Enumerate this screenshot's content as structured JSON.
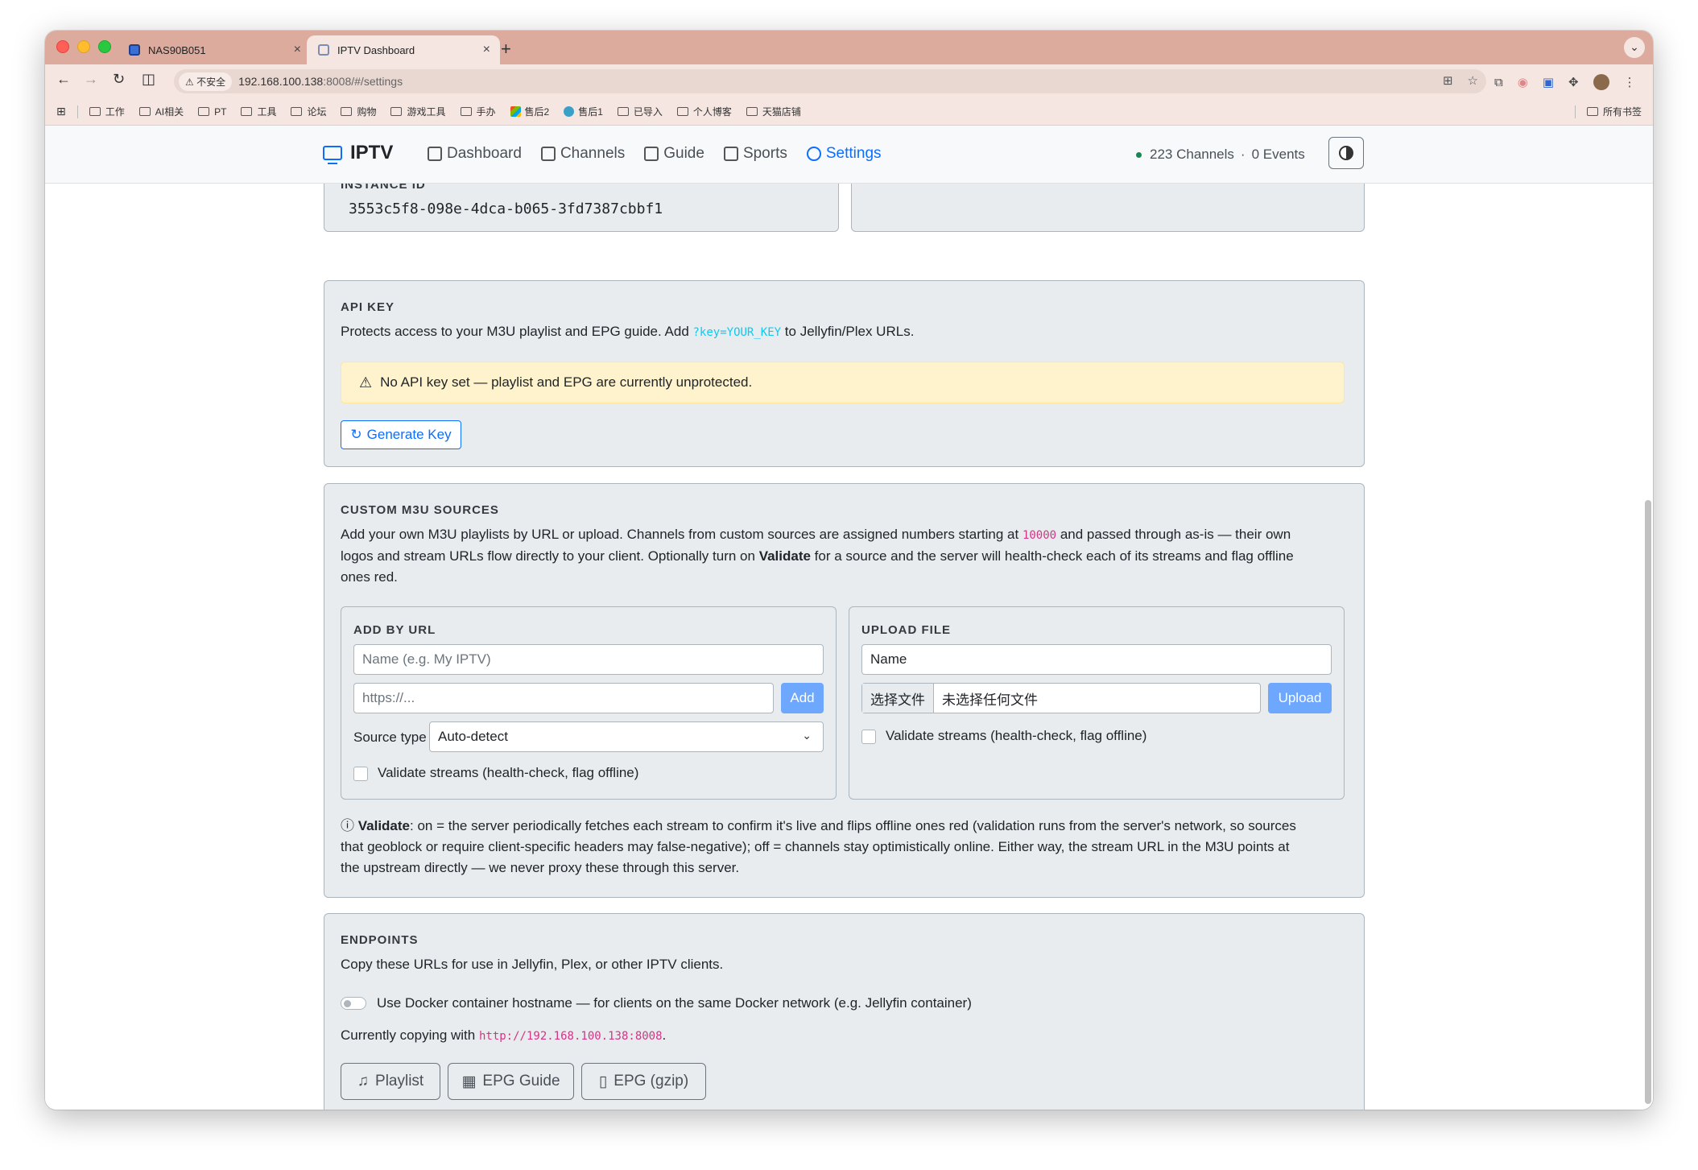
{
  "browser": {
    "tabs": [
      {
        "label": "NAS90B051"
      },
      {
        "label": "IPTV Dashboard"
      }
    ],
    "insecure_label": "不安全",
    "url_host": "192.168.100.138",
    "url_rest": ":8008/#/settings",
    "bookmarks": [
      "工作",
      "AI相关",
      "PT",
      "工具",
      "论坛",
      "购物",
      "游戏工具",
      "手办",
      "售后2",
      "售后1",
      "已导入",
      "个人博客",
      "天猫店铺"
    ],
    "bookmarks_right": "所有书签"
  },
  "nav": {
    "brand": "IPTV",
    "links": [
      {
        "label": "Dashboard"
      },
      {
        "label": "Channels"
      },
      {
        "label": "Guide"
      },
      {
        "label": "Sports"
      },
      {
        "label": "Settings"
      }
    ],
    "channels_count": "223 Channels",
    "events_count": "0 Events",
    "separator": "·"
  },
  "instance": {
    "label": "INSTANCE ID",
    "value": "3553c5f8-098e-4dca-b065-3fd7387cbbf1"
  },
  "api_key": {
    "title": "API KEY",
    "desc_pre": "Protects access to your M3U playlist and EPG guide. Add ",
    "desc_code": "?key=YOUR_KEY",
    "desc_post": " to Jellyfin/Plex URLs.",
    "alert": "No API key set — playlist and EPG are currently unprotected.",
    "generate_button": "Generate Key"
  },
  "custom_m3u": {
    "title": "CUSTOM M3U SOURCES",
    "desc_1": "Add your own M3U playlists by URL or upload. Channels from custom sources are assigned numbers starting at ",
    "desc_code": "10000",
    "desc_2": " and passed through as-is — their own",
    "desc_3_pre": "logos and stream URLs flow directly to your client. Optionally turn on ",
    "desc_3_bold": "Validate",
    "desc_3_post": " for a source and the server will health-check each of its streams and flag offline",
    "desc_4": "ones red.",
    "add_by_url": {
      "title": "ADD BY URL",
      "name_placeholder": "Name (e.g. My IPTV)",
      "url_placeholder": "https://...",
      "add_button": "Add",
      "source_type_label": "Source type",
      "source_type_value": "Auto-detect",
      "validate_label": "Validate streams (health-check, flag offline)"
    },
    "upload_file": {
      "title": "UPLOAD FILE",
      "name_placeholder": "Name",
      "choose_file": "选择文件",
      "no_file": "未选择任何文件",
      "upload_button": "Upload",
      "validate_label": "Validate streams (health-check, flag offline)"
    },
    "validate_note_bold": "Validate",
    "validate_note_1": ": on = the server periodically fetches each stream to confirm it's live and flips offline ones red (validation runs from the server's network, so sources",
    "validate_note_2": "that geoblock or require client-specific headers may false-negative); off = channels stay optimistically online. Either way, the stream URL in the M3U points at",
    "validate_note_3": "the upstream directly — we never proxy these through this server."
  },
  "endpoints": {
    "title": "ENDPOINTS",
    "desc": "Copy these URLs for use in Jellyfin, Plex, or other IPTV clients.",
    "docker_label": "Use Docker container hostname",
    "docker_desc": " — for clients on the same Docker network (e.g. Jellyfin container)",
    "copying_pre": "Currently copying with ",
    "copying_url": "http://192.168.100.138:8008",
    "copying_post": ".",
    "buttons": [
      {
        "label": "Playlist"
      },
      {
        "label": "EPG Guide"
      },
      {
        "label": "EPG (gzip)"
      }
    ]
  },
  "colors": {
    "primary": "#0d6efd",
    "tabbar": "#dcab9e",
    "warning_bg": "#fff3cd",
    "code_pink": "#d63384"
  }
}
